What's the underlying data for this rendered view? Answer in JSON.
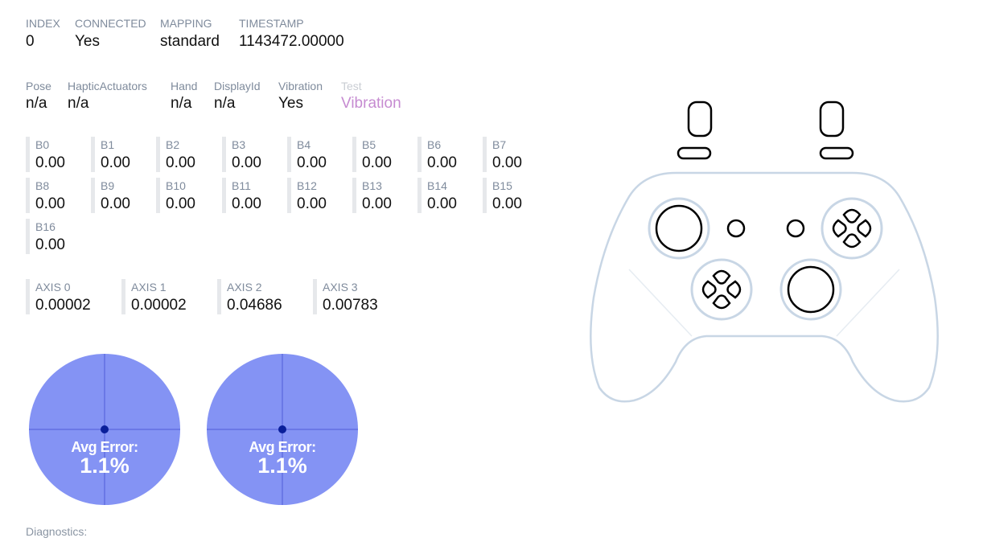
{
  "info": {
    "index": {
      "label": "INDEX",
      "value": "0"
    },
    "connected": {
      "label": "CONNECTED",
      "value": "Yes"
    },
    "mapping": {
      "label": "MAPPING",
      "value": "standard"
    },
    "timestamp": {
      "label": "TIMESTAMP",
      "value": "1143472.00000"
    }
  },
  "pose_row": {
    "pose": {
      "label": "Pose",
      "value": "n/a"
    },
    "haptic": {
      "label": "HapticActuators",
      "value": "n/a"
    },
    "hand": {
      "label": "Hand",
      "value": "n/a"
    },
    "display": {
      "label": "DisplayId",
      "value": "n/a"
    },
    "vibration": {
      "label": "Vibration",
      "value": "Yes"
    },
    "test": {
      "label": "Test",
      "value": "Vibration"
    }
  },
  "buttons": [
    {
      "label": "B0",
      "value": "0.00"
    },
    {
      "label": "B1",
      "value": "0.00"
    },
    {
      "label": "B2",
      "value": "0.00"
    },
    {
      "label": "B3",
      "value": "0.00"
    },
    {
      "label": "B4",
      "value": "0.00"
    },
    {
      "label": "B5",
      "value": "0.00"
    },
    {
      "label": "B6",
      "value": "0.00"
    },
    {
      "label": "B7",
      "value": "0.00"
    },
    {
      "label": "B8",
      "value": "0.00"
    },
    {
      "label": "B9",
      "value": "0.00"
    },
    {
      "label": "B10",
      "value": "0.00"
    },
    {
      "label": "B11",
      "value": "0.00"
    },
    {
      "label": "B12",
      "value": "0.00"
    },
    {
      "label": "B13",
      "value": "0.00"
    },
    {
      "label": "B14",
      "value": "0.00"
    },
    {
      "label": "B15",
      "value": "0.00"
    },
    {
      "label": "B16",
      "value": "0.00"
    }
  ],
  "axes": [
    {
      "label": "AXIS 0",
      "value": "0.00002"
    },
    {
      "label": "AXIS 1",
      "value": "0.00002"
    },
    {
      "label": "AXIS 2",
      "value": "0.04686"
    },
    {
      "label": "AXIS 3",
      "value": "0.00783"
    }
  ],
  "sticks": [
    {
      "error_title": "Avg Error:",
      "error_value": "1.1%"
    },
    {
      "error_title": "Avg Error:",
      "error_value": "1.1%"
    }
  ],
  "diagnostics_label": "Diagnostics:",
  "colors": {
    "stick_fill": "#8493f4",
    "stick_dot": "#0a1f9a",
    "test_link": "#c68bd1",
    "controller_outline": "#c8d6e5"
  }
}
